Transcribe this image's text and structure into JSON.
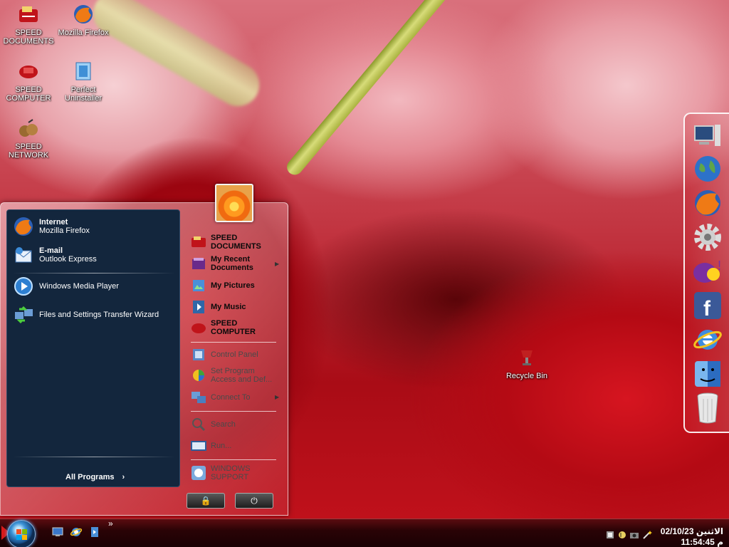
{
  "desktop": {
    "icons": [
      {
        "label_line1": "SPEED",
        "label_line2": "DOCUMENTS",
        "icon": "speed-documents-icon"
      },
      {
        "label_line1": "Mozilla Firefox",
        "label_line2": "",
        "icon": "firefox-icon"
      },
      {
        "label_line1": "SPEED",
        "label_line2": "COMPUTER",
        "icon": "speed-computer-icon"
      },
      {
        "label_line1": "Perfect",
        "label_line2": "Uninstaller",
        "icon": "perfect-uninstaller-icon"
      },
      {
        "label_line1": "SPEED",
        "label_line2": "NETWORK",
        "icon": "speed-network-icon"
      },
      {
        "label_line1": "Recycle Bin",
        "label_line2": "",
        "icon": "recycle-bin-icon"
      }
    ]
  },
  "start_menu": {
    "pinned": [
      {
        "title": "Internet",
        "subtitle": "Mozilla Firefox",
        "icon": "firefox-icon"
      },
      {
        "title": "E-mail",
        "subtitle": "Outlook Express",
        "icon": "outlook-express-icon"
      }
    ],
    "recent": [
      {
        "label": "Windows Media Player",
        "icon": "media-player-icon"
      },
      {
        "label": "Files and Settings Transfer Wizard",
        "icon": "transfer-wizard-icon"
      }
    ],
    "all_programs": "All Programs",
    "right": [
      {
        "line1": "SPEED",
        "line2": "DOCUMENTS",
        "icon": "speed-documents-icon"
      },
      {
        "line1": "My Recent",
        "line2": "Documents",
        "icon": "recent-documents-icon"
      },
      {
        "line1": "My Pictures",
        "line2": "",
        "icon": "pictures-icon"
      },
      {
        "line1": "My Music",
        "line2": "",
        "icon": "music-icon"
      },
      {
        "line1": "SPEED",
        "line2": "COMPUTER",
        "icon": "speed-computer-icon"
      },
      {
        "line1": "Control Panel",
        "line2": "",
        "icon": "control-panel-icon"
      },
      {
        "line1": "Set Program",
        "line2": "Access and Def...",
        "icon": "set-program-access-icon"
      },
      {
        "line1": "Connect To",
        "line2": "",
        "icon": "connect-to-icon"
      },
      {
        "line1": "Search",
        "line2": "",
        "icon": "search-icon"
      },
      {
        "line1": "Run...",
        "line2": "",
        "icon": "run-icon"
      },
      {
        "line1": "WINDOWS",
        "line2": "SUPPORT",
        "icon": "windows-support-icon"
      }
    ],
    "lock_symbol": "🔒",
    "power_symbol": "⏻"
  },
  "taskbar": {
    "chevron": "»",
    "clock_date": "الاثنين 02/10/23",
    "clock_time": "م 11:54:45"
  },
  "dock": [
    "computer-icon",
    "globe-icon",
    "firefox-icon",
    "settings-gear-icon",
    "yahoo-messenger-icon",
    "facebook-icon",
    "internet-explorer-icon",
    "finder-icon",
    "trash-icon"
  ],
  "colors": {
    "start_left_pane": "#13263d",
    "taskbar": "#2a0306",
    "accent": "#d81a1a"
  }
}
